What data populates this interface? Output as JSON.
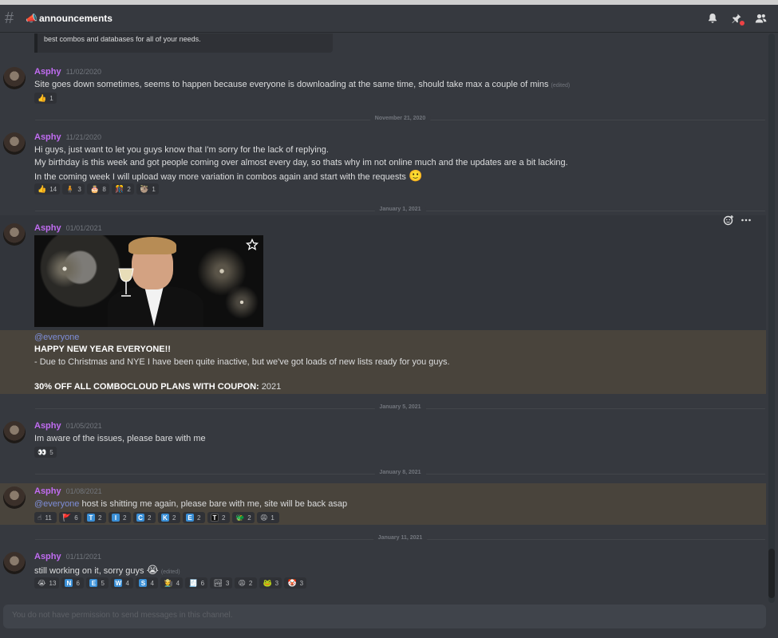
{
  "channel": {
    "name": "announcements",
    "emoji": "📣"
  },
  "embed_tail_text": "best combos and databases for all of your needs.",
  "divider_labels": [
    "November 21, 2020",
    "January 1, 2021",
    "January 5, 2021",
    "January 8, 2021",
    "January 11, 2021"
  ],
  "messages": [
    {
      "author": "Asphy",
      "timestamp": "11/02/2020",
      "line1": "Site goes down sometimes, seems to happen because everyone is downloading at the same time, should take max a couple of mins",
      "edited": "(edited)",
      "reactions": [
        {
          "emoji": "👍",
          "count": "1"
        }
      ]
    },
    {
      "author": "Asphy",
      "timestamp": "11/21/2020",
      "line1": "Hi guys, just want to let you guys know that I'm sorry for the lack of replying.",
      "line2": "My birthday is this week and got people coming over almost every day, so thats why im not online much and the updates are a bit lacking.",
      "line3": "In the coming week I will upload way more variation in combos again and start with the requests",
      "line3_emoji": "🙂",
      "reactions": [
        {
          "emoji": "👍",
          "count": "14"
        },
        {
          "emoji": "🧍",
          "count": "3"
        },
        {
          "emoji": "🎂",
          "count": "8"
        },
        {
          "emoji": "🎊",
          "count": "2"
        },
        {
          "emoji": "🦥",
          "count": "1"
        }
      ]
    },
    {
      "author": "Asphy",
      "timestamp": "01/01/2021",
      "mention": "@everyone",
      "line1": "HAPPY NEW YEAR EVERYONE!!",
      "line2": "- Due to Christmas and NYE I have been quite inactive, but we've got loads of new lists ready for you guys.",
      "line3_bold": "30% OFF ALL COMBOCLOUD PLANS WITH COUPON:",
      "line3_rest": " 2021"
    },
    {
      "author": "Asphy",
      "timestamp": "01/05/2021",
      "line1": "Im aware of the issues, please bare with me",
      "reactions": [
        {
          "emoji": "👀",
          "count": "5"
        }
      ]
    },
    {
      "author": "Asphy",
      "timestamp": "01/08/2021",
      "mention": "@everyone",
      "line1": " host is shitting me again, please bare with me, site will be back asap",
      "reactions": [
        {
          "emoji": "☝",
          "count": "11"
        },
        {
          "emoji": "🚩",
          "count": "6"
        },
        {
          "letter": "T",
          "style": "blue",
          "count": "2"
        },
        {
          "letter": "I",
          "style": "blue",
          "count": "2"
        },
        {
          "letter": "C",
          "style": "blue",
          "count": "2"
        },
        {
          "letter": "K",
          "style": "blue",
          "count": "2"
        },
        {
          "letter": "E",
          "style": "blue",
          "count": "2"
        },
        {
          "letter": "T",
          "style": "dark",
          "count": "2"
        },
        {
          "emoji": "🐲",
          "count": "2"
        },
        {
          "emoji": "😩",
          "count": "1"
        }
      ]
    },
    {
      "author": "Asphy",
      "timestamp": "01/11/2021",
      "line1": "still working on it, sorry guys",
      "line1_emoji": "😭",
      "edited": "(edited)",
      "reactions": [
        {
          "emoji": "😭",
          "count": "13"
        },
        {
          "letter": "N",
          "style": "blue",
          "count": "6"
        },
        {
          "letter": "E",
          "style": "blue",
          "count": "5"
        },
        {
          "letter": "W",
          "style": "blue",
          "count": "4"
        },
        {
          "letter": "S",
          "style": "blue",
          "count": "4"
        },
        {
          "emoji": "🧑‍🌾",
          "count": "4"
        },
        {
          "emoji": "🧾",
          "count": "6"
        },
        {
          "emoji": "🏞",
          "count": "3"
        },
        {
          "emoji": "😩",
          "count": "2"
        },
        {
          "emoji": "🐸",
          "count": "3"
        },
        {
          "emoji": "🤡",
          "count": "3"
        }
      ]
    }
  ],
  "composer_placeholder": "You do not have permission to send messages in this channel.",
  "icons": [
    "hash-icon",
    "bell-icon",
    "pin-icon",
    "members-icon",
    "add-reaction-icon",
    "more-icon",
    "star-icon"
  ],
  "colors": {
    "author": "#c16cf2",
    "mention": "#7e8ed9",
    "highlight": "#49443c",
    "background": "#36393f"
  }
}
